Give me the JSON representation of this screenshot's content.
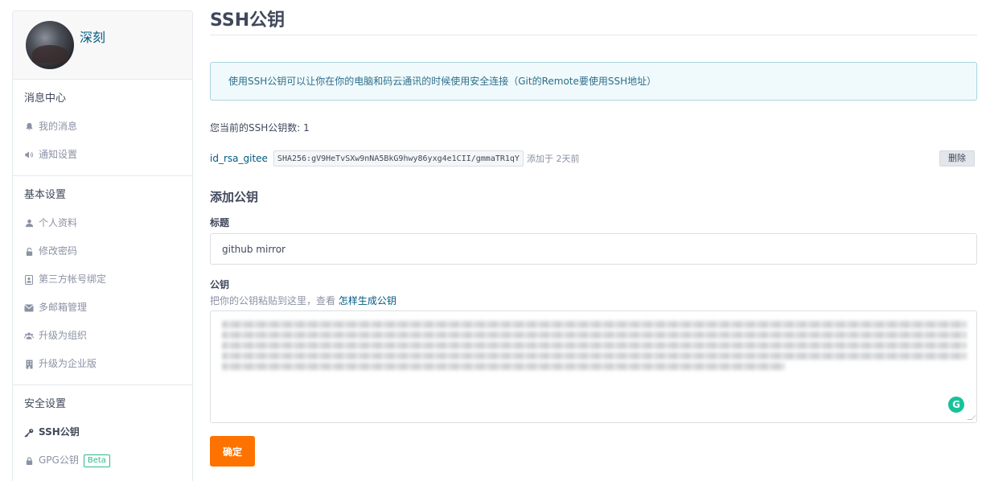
{
  "sidebar": {
    "username": "深刻",
    "sections": [
      {
        "title": "消息中心",
        "items": [
          {
            "label": "我的消息",
            "icon": "bell-icon"
          },
          {
            "label": "通知设置",
            "icon": "volume-icon"
          }
        ]
      },
      {
        "title": "基本设置",
        "items": [
          {
            "label": "个人资料",
            "icon": "user-icon"
          },
          {
            "label": "修改密码",
            "icon": "unlock-icon"
          },
          {
            "label": "第三方帐号绑定",
            "icon": "contact-card-icon"
          },
          {
            "label": "多邮箱管理",
            "icon": "envelope-icon"
          },
          {
            "label": "升级为组织",
            "icon": "users-icon"
          },
          {
            "label": "升级为企业版",
            "icon": "building-icon"
          }
        ]
      },
      {
        "title": "安全设置",
        "items": [
          {
            "label": "SSH公钥",
            "icon": "key-icon",
            "active": true
          },
          {
            "label": "GPG公钥",
            "icon": "lock-icon",
            "badge": "Beta"
          }
        ]
      }
    ]
  },
  "main": {
    "title": "SSH公钥",
    "notice": "使用SSH公钥可以让你在你的电脑和码云通讯的时候使用安全连接（Git的Remote要使用SSH地址）",
    "key_count": "您当前的SSH公钥数: 1",
    "keys": [
      {
        "name": "id_rsa_gitee",
        "fingerprint": "SHA256:gV9HeTvSXw9nNA5BkG9hwy86yxg4e1CII/gmmaTR1qY",
        "added": "添加于 2天前",
        "delete_label": "删除"
      }
    ],
    "add_title": "添加公钥",
    "title_label": "标题",
    "title_value": "github mirror",
    "key_label": "公钥",
    "key_hint": "把你的公钥粘贴到这里，查看",
    "key_hint_link": "怎样生成公钥",
    "grammarly_letter": "G",
    "confirm_label": "确定"
  },
  "colors": {
    "accent": "#fe7300",
    "link": "#005980",
    "notice_bg": "#f0fafc",
    "beta": "#2bbc8a"
  }
}
